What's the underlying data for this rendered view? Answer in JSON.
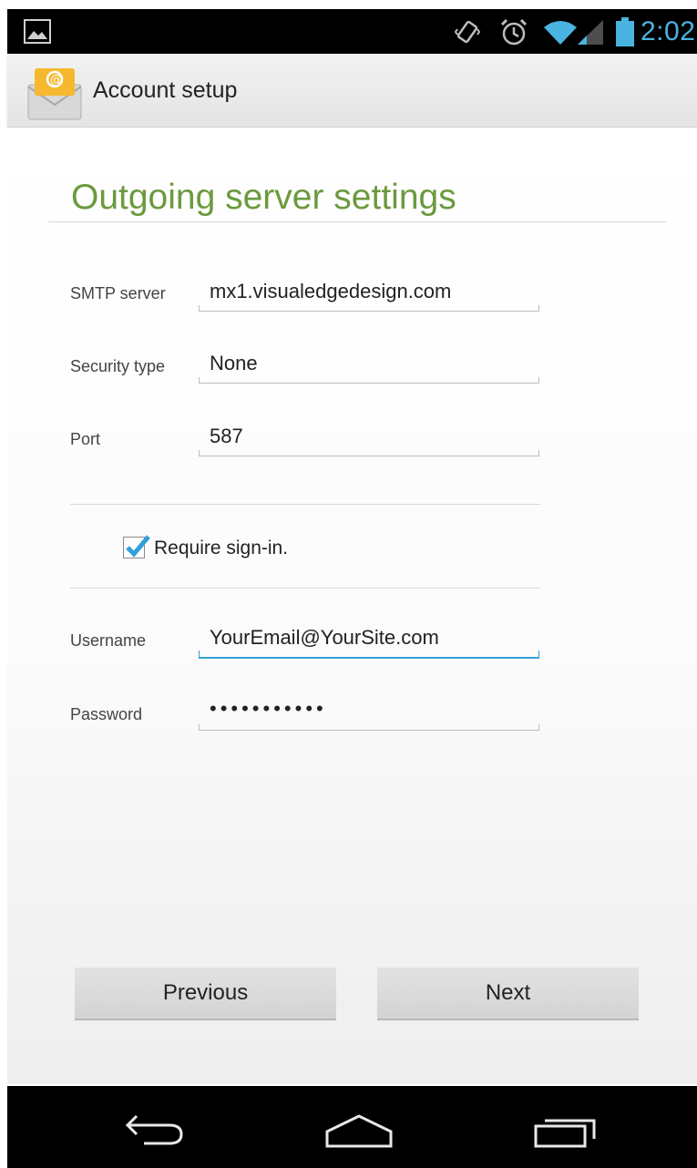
{
  "status_bar": {
    "time": "2:02",
    "icons": [
      "photo-icon",
      "vibrate-icon",
      "alarm-icon",
      "wifi-icon",
      "cell-signal-icon",
      "battery-icon"
    ],
    "accent_color": "#4ab3df"
  },
  "action_bar": {
    "title": "Account setup",
    "icon": "email-app-icon"
  },
  "page": {
    "title": "Outgoing server settings",
    "title_color": "#6b9a3e"
  },
  "form": {
    "smtp_label": "SMTP server",
    "smtp_value": "mx1.visualedgedesign.com",
    "security_label": "Security type",
    "security_value": "None",
    "port_label": "Port",
    "port_value": "587",
    "require_signin_label": "Require sign-in.",
    "require_signin_checked": true,
    "username_label": "Username",
    "username_value": "YourEmail@YourSite.com",
    "password_label": "Password",
    "password_value": "•••••••••••"
  },
  "buttons": {
    "previous": "Previous",
    "next": "Next"
  },
  "nav_bar": {
    "icons": [
      "back-icon",
      "home-icon",
      "recent-apps-icon"
    ]
  }
}
